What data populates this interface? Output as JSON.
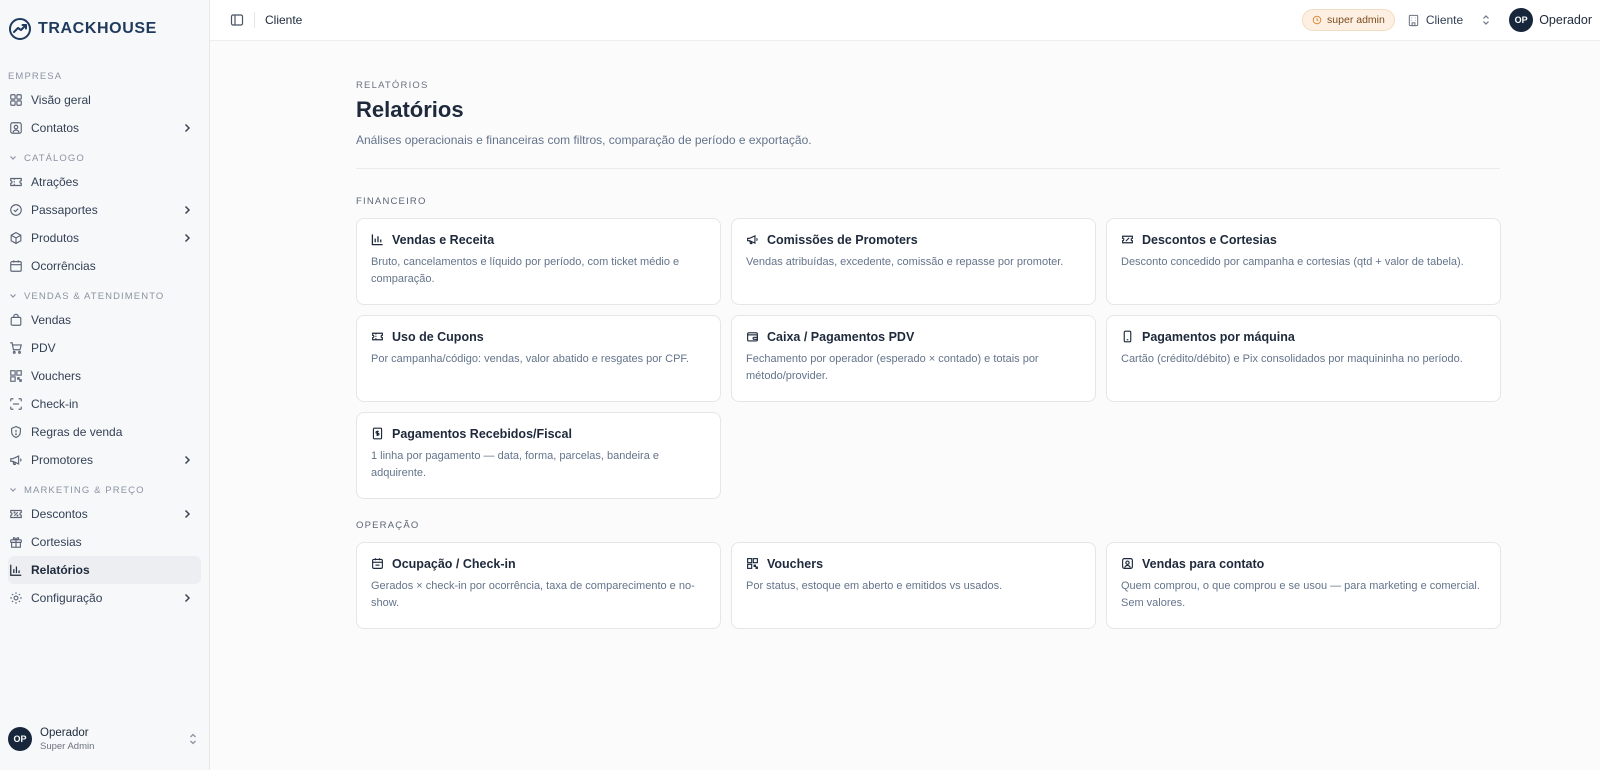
{
  "brand": {
    "name": "TRACKHOUSE"
  },
  "sidebar": {
    "sections": [
      {
        "label": "EMPRESA",
        "items": [
          {
            "label": "Visão geral",
            "icon": "grid-icon"
          },
          {
            "label": "Contatos",
            "icon": "contact-icon",
            "has_children": true
          }
        ]
      },
      {
        "label": "CATÁLOGO",
        "items": [
          {
            "label": "Atrações",
            "icon": "ticket-icon"
          },
          {
            "label": "Passaportes",
            "icon": "badge-check-icon",
            "has_children": true
          },
          {
            "label": "Produtos",
            "icon": "package-icon",
            "has_children": true
          },
          {
            "label": "Ocorrências",
            "icon": "calendar-icon"
          }
        ]
      },
      {
        "label": "VENDAS & ATENDIMENTO",
        "items": [
          {
            "label": "Vendas",
            "icon": "shopping-bag-icon"
          },
          {
            "label": "PDV",
            "icon": "cart-icon"
          },
          {
            "label": "Vouchers",
            "icon": "qr-code-icon"
          },
          {
            "label": "Check-in",
            "icon": "scan-icon"
          },
          {
            "label": "Regras de venda",
            "icon": "shield-icon"
          },
          {
            "label": "Promotores",
            "icon": "megaphone-icon",
            "has_children": true
          }
        ]
      },
      {
        "label": "MARKETING & PREÇO",
        "items": [
          {
            "label": "Descontos",
            "icon": "ticket-percent-icon",
            "has_children": true
          },
          {
            "label": "Cortesias",
            "icon": "gift-icon"
          },
          {
            "label": "Relatórios",
            "icon": "bar-chart-icon",
            "active": true
          },
          {
            "label": "Configuração",
            "icon": "gear-icon",
            "has_children": true
          }
        ]
      }
    ],
    "footer": {
      "initials": "OP",
      "name": "Operador",
      "role": "Super Admin"
    }
  },
  "topbar": {
    "breadcrumb": "Cliente",
    "role_badge": "super admin",
    "org": "Cliente",
    "user_initials": "OP",
    "user_name": "Operador"
  },
  "page": {
    "eyebrow": "RELATÓRIOS",
    "title": "Relatórios",
    "description": "Análises operacionais e financeiras com filtros, comparação de período e exportação."
  },
  "groups": [
    {
      "label": "FINANCEIRO",
      "cards": [
        {
          "title": "Vendas e Receita",
          "icon": "bar-chart-icon",
          "description": "Bruto, cancelamentos e líquido por período, com ticket médio e comparação."
        },
        {
          "title": "Comissões de Promoters",
          "icon": "megaphone-icon",
          "description": "Vendas atribuídas, excedente, comissão e repasse por promoter."
        },
        {
          "title": "Descontos e Cortesias",
          "icon": "ticket-percent-icon",
          "description": "Desconto concedido por campanha e cortesias (qtd + valor de tabela)."
        },
        {
          "title": "Uso de Cupons",
          "icon": "ticket-icon",
          "description": "Por campanha/código: vendas, valor abatido e resgates por CPF."
        },
        {
          "title": "Caixa / Pagamentos PDV",
          "icon": "wallet-icon",
          "description": "Fechamento por operador (esperado × contado) e totais por método/provider."
        },
        {
          "title": "Pagamentos por máquina",
          "icon": "smartphone-icon",
          "description": "Cartão (crédito/débito) e Pix consolidados por maquininha no período."
        },
        {
          "title": "Pagamentos Recebidos/Fiscal",
          "icon": "receipt-icon",
          "description": "1 linha por pagamento — data, forma, parcelas, bandeira e adquirente."
        }
      ]
    },
    {
      "label": "OPERAÇÃO",
      "cards": [
        {
          "title": "Ocupação / Check-in",
          "icon": "calendar-check-icon",
          "description": "Gerados × check-in por ocorrência, taxa de comparecimento e no-show."
        },
        {
          "title": "Vouchers",
          "icon": "qr-code-icon",
          "description": "Por status, estoque em aberto e emitidos vs usados."
        },
        {
          "title": "Vendas para contato",
          "icon": "contact-icon",
          "description": "Quem comprou, o que comprou e se usou — para marketing e comercial. Sem valores."
        }
      ]
    }
  ]
}
